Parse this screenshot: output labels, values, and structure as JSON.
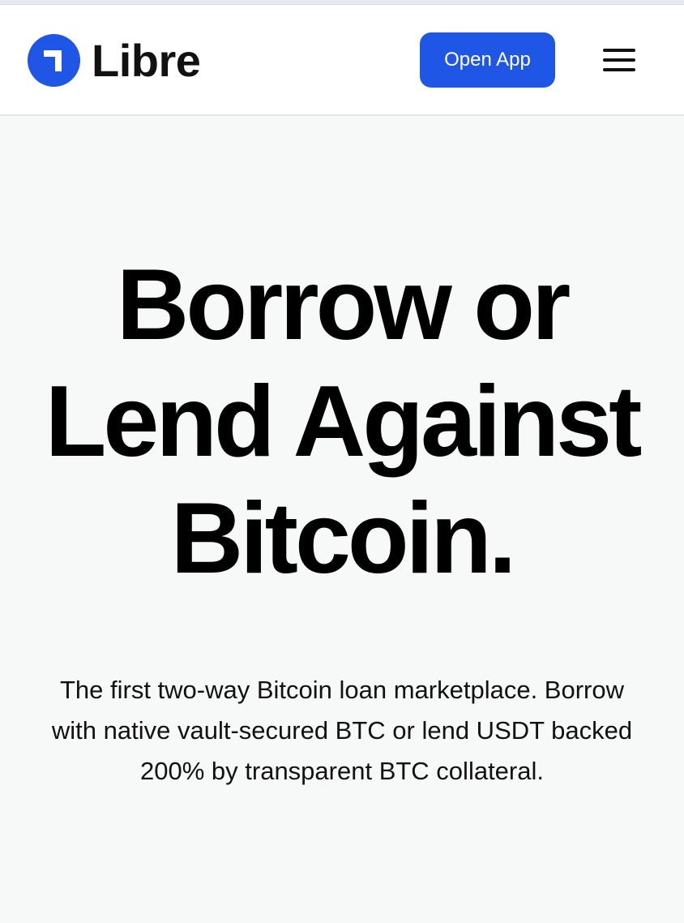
{
  "header": {
    "brand": "Libre",
    "open_app_label": "Open App",
    "logo_icon": "libre-logo-icon",
    "menu_icon": "hamburger-menu-icon"
  },
  "hero": {
    "title_lines": [
      "Borrow or",
      "Lend Against",
      "Bitcoin."
    ],
    "subtitle": "The first two-way Bitcoin loan marketplace. Borrow with native vault-secured BTC or lend USDT backed 200% by transparent BTC collateral."
  },
  "colors": {
    "accent": "#1f56e6",
    "background": "#f7f8f8",
    "header_background": "#ffffff",
    "text": "#000000"
  }
}
